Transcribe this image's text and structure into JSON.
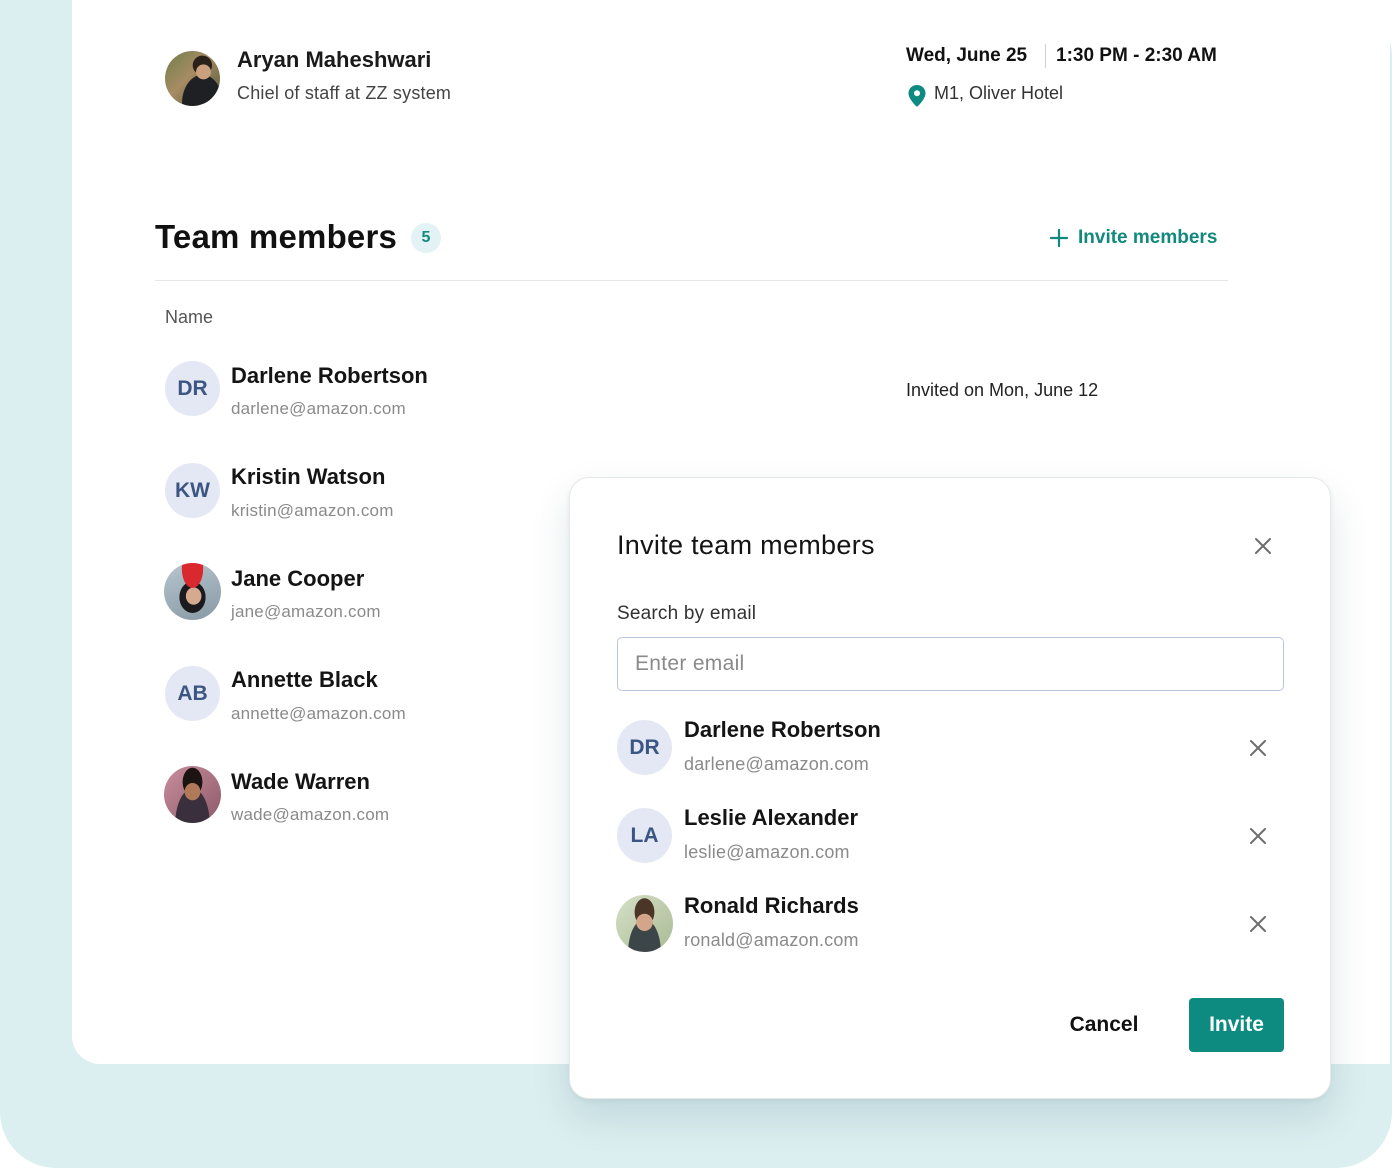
{
  "host": {
    "name": "Aryan Maheshwari",
    "role": "Chiel of staff at ZZ system"
  },
  "event": {
    "date": "Wed, June 25",
    "time": "1:30 PM - 2:30 AM",
    "location": "M1, Oliver Hotel"
  },
  "team": {
    "title": "Team members",
    "count": "5",
    "invite_link": "Invite members",
    "column_name": "Name",
    "members": [
      {
        "initials": "DR",
        "name": "Darlene Robertson",
        "email": "darlene@amazon.com",
        "status": "Invited on Mon, June 12"
      },
      {
        "initials": "KW",
        "name": "Kristin Watson",
        "email": "kristin@amazon.com"
      },
      {
        "initials": "",
        "name": "Jane Cooper",
        "email": "jane@amazon.com"
      },
      {
        "initials": "AB",
        "name": "Annette Black",
        "email": "annette@amazon.com"
      },
      {
        "initials": "",
        "name": "Wade Warren",
        "email": "wade@amazon.com"
      }
    ]
  },
  "modal": {
    "title": "Invite team members",
    "search_label": "Search by email",
    "search_placeholder": "Enter email",
    "search_value": "",
    "selected": [
      {
        "initials": "DR",
        "name": "Darlene Robertson",
        "email": "darlene@amazon.com"
      },
      {
        "initials": "LA",
        "name": "Leslie Alexander",
        "email": "leslie@amazon.com"
      },
      {
        "initials": "",
        "name": "Ronald Richards",
        "email": "ronald@amazon.com"
      }
    ],
    "cancel_label": "Cancel",
    "invite_label": "Invite"
  },
  "colors": {
    "accent": "#0d8b80",
    "background": "#dbeef0",
    "avatar_bg": "#e4e8f4",
    "avatar_text": "#3c5683"
  }
}
